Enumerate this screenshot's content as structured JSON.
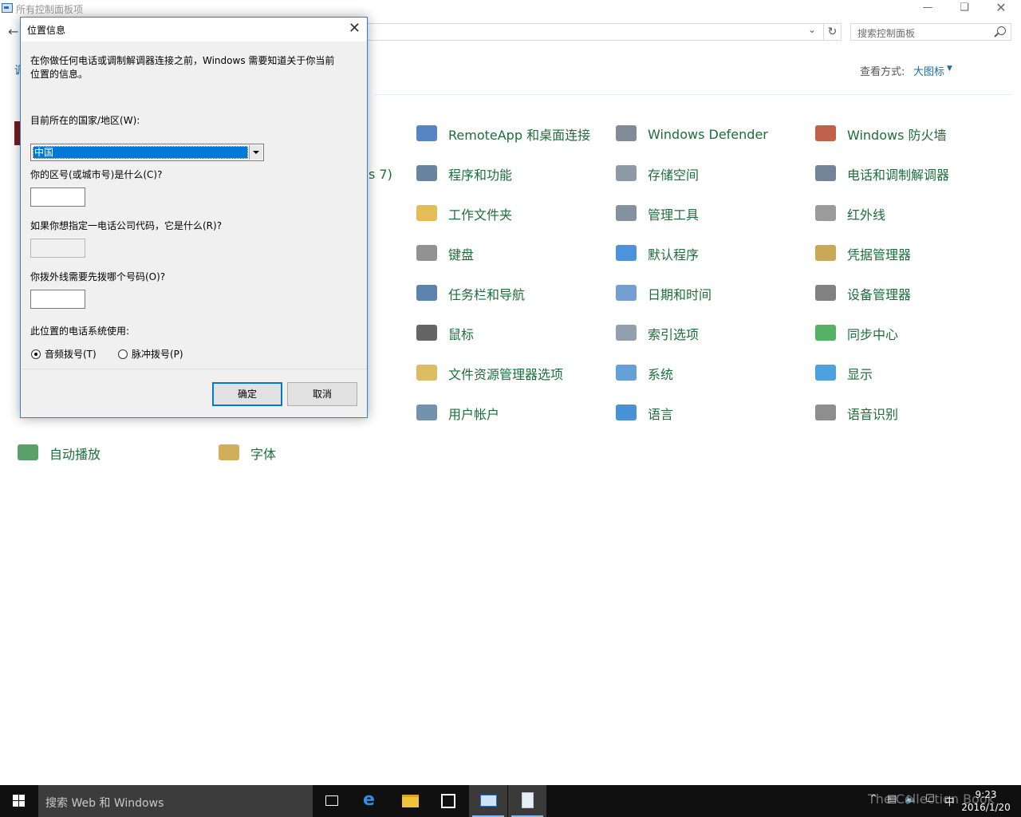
{
  "window": {
    "title": "所有控制面板项",
    "search_placeholder": "搜索控制面板",
    "left_stub": "调",
    "view_by_label": "查看方式:",
    "view_by_value": "大图标",
    "partial_text": "s 7)"
  },
  "items": [
    {
      "label": "RemoteApp 和桌面连接",
      "icon": "remoteapp-icon"
    },
    {
      "label": "Windows Defender",
      "icon": "defender-icon"
    },
    {
      "label": "Windows 防火墙",
      "icon": "firewall-icon"
    },
    {
      "label": "程序和功能",
      "icon": "programs-icon"
    },
    {
      "label": "存储空间",
      "icon": "storage-icon"
    },
    {
      "label": "电话和调制解调器",
      "icon": "phone-modem-icon"
    },
    {
      "label": "工作文件夹",
      "icon": "work-folders-icon"
    },
    {
      "label": "管理工具",
      "icon": "admin-tools-icon"
    },
    {
      "label": "红外线",
      "icon": "infrared-icon"
    },
    {
      "label": "键盘",
      "icon": "keyboard-icon"
    },
    {
      "label": "默认程序",
      "icon": "default-programs-icon"
    },
    {
      "label": "凭据管理器",
      "icon": "credential-manager-icon"
    },
    {
      "label": "任务栏和导航",
      "icon": "taskbar-nav-icon"
    },
    {
      "label": "日期和时间",
      "icon": "date-time-icon"
    },
    {
      "label": "设备管理器",
      "icon": "device-manager-icon"
    },
    {
      "label": "鼠标",
      "icon": "mouse-icon"
    },
    {
      "label": "索引选项",
      "icon": "indexing-icon"
    },
    {
      "label": "同步中心",
      "icon": "sync-center-icon"
    },
    {
      "label": "文件资源管理器选项",
      "icon": "explorer-options-icon"
    },
    {
      "label": "系统",
      "icon": "system-icon"
    },
    {
      "label": "显示",
      "icon": "display-icon"
    },
    {
      "label": "用户帐户",
      "icon": "user-accounts-icon"
    },
    {
      "label": "语言",
      "icon": "language-icon"
    },
    {
      "label": "语音识别",
      "icon": "speech-icon"
    },
    {
      "label": "自动播放",
      "icon": "autoplay-icon"
    },
    {
      "label": "字体",
      "icon": "fonts-icon"
    }
  ],
  "dialog": {
    "title": "位置信息",
    "intro_line1": "在你做任何电话或调制解调器连接之前，Windows 需要知道关于你当前",
    "intro_line2": "位置的信息。",
    "country_label": "目前所在的国家/地区(W):",
    "country_value": "中国",
    "area_code_label": "你的区号(或城市号)是什么(C)?",
    "area_code_value": "",
    "carrier_label": "如果你想指定一电话公司代码，它是什么(R)?",
    "carrier_value": "",
    "outside_line_label": "你拨外线需要先拨哪个号码(O)?",
    "outside_line_value": "",
    "dialing_label": "此位置的电话系统使用:",
    "tone_label": "音频拨号(T)",
    "pulse_label": "脉冲拨号(P)",
    "ok_label": "确定",
    "cancel_label": "取消"
  },
  "taskbar": {
    "search_text": "搜索 Web 和 Windows",
    "tray_ime": "中",
    "time": "9:23",
    "date": "2016/1/20",
    "watermark": "The Collection Book"
  }
}
